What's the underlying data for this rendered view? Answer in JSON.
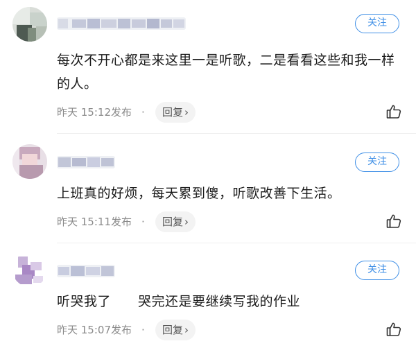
{
  "comments": [
    {
      "follow_label": "关注",
      "text": "每次不开心都是来这里一是听歌，二是看看这些和我一样的人。",
      "time": "昨天 15:12发布",
      "separator": "·",
      "reply_label": "回复",
      "reply_chevron": "›"
    },
    {
      "follow_label": "关注",
      "text": "上班真的好烦，每天累到傻，听歌改善下生活。",
      "time": "昨天 15:11发布",
      "separator": "·",
      "reply_label": "回复",
      "reply_chevron": "›"
    },
    {
      "follow_label": "关注",
      "text": "听哭我了　　哭完还是要继续写我的作业",
      "time": "昨天 15:07发布",
      "separator": "·",
      "reply_label": "回复",
      "reply_chevron": "›"
    }
  ],
  "icons": {
    "like": "thumbs-up-icon",
    "reply_chevron": "chevron-right-icon"
  },
  "colors": {
    "accent": "#3f8fe6",
    "meta_text": "#8a8a8a",
    "reply_bg": "#f3f3f3"
  }
}
